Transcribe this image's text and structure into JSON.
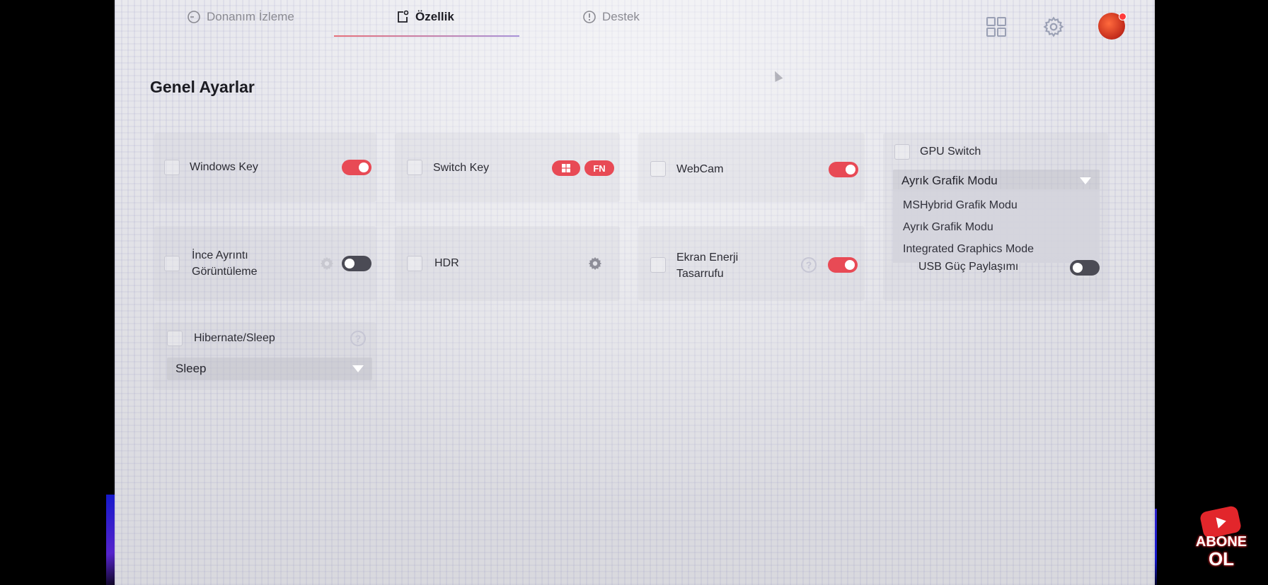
{
  "tabs": [
    {
      "label": "Donanım İzleme",
      "icon": "clock-icon",
      "active": false
    },
    {
      "label": "Özellik",
      "icon": "feature-icon",
      "active": true
    },
    {
      "label": "Destek",
      "icon": "alert-icon",
      "active": false
    }
  ],
  "header_icons": [
    "grid-icon",
    "gear-icon",
    "avatar"
  ],
  "section": {
    "title": "Genel Ayarlar"
  },
  "settings": {
    "windows_key": {
      "label": "Windows Key",
      "enabled": true
    },
    "switch_key": {
      "label": "Switch Key",
      "options": [
        "windows-icon",
        "FN"
      ],
      "fn_label": "FN"
    },
    "webcam": {
      "label": "WebCam",
      "enabled": true
    },
    "gpu_switch": {
      "label": "GPU Switch",
      "selected": "Ayrık Grafik Modu",
      "options": [
        "MSHybrid Grafik Modu",
        "Ayrık Grafik Modu",
        "Integrated Graphics Mode"
      ]
    },
    "fine_detail": {
      "label_line1": "İnce Ayrıntı",
      "label_line2": "Görüntüleme",
      "enabled": false
    },
    "hdr": {
      "label": "HDR"
    },
    "screen_power": {
      "label_line1": "Ekran Enerji",
      "label_line2": "Tasarrufu",
      "enabled": true
    },
    "usb_power": {
      "label": "USB Güç Paylaşımı",
      "enabled": false
    },
    "hibernate": {
      "label": "Hibernate/Sleep",
      "selected": "Sleep"
    }
  },
  "overlay": {
    "line1": "ABONE",
    "line2": "OL"
  },
  "colors": {
    "accent": "#e84a55",
    "toggle_off": "#4b4b55"
  }
}
